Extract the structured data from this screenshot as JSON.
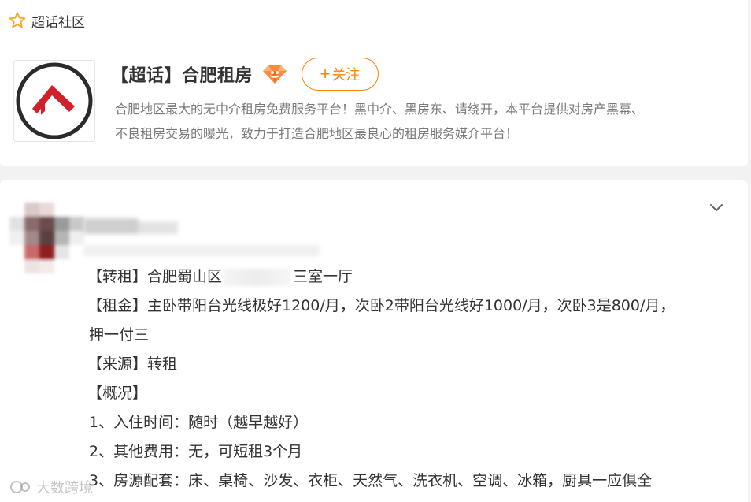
{
  "breadcrumb": {
    "icon": "star-outline-icon",
    "label": "超话社区"
  },
  "topic": {
    "title": "【超话】合肥租房",
    "badge_icon": "diamond-gem-icon",
    "follow_label": "关注",
    "follow_icon": "plus-icon",
    "description_lines": [
      "合肥地区最大的无中介租房免费服务平台！黑中介、黑房东、请绕开，本平台提供对房产黑幕、",
      "不良租房交易的曝光，致力于打造合肥地区最良心的租房服务媒介平台！"
    ],
    "logo_icon": "house-roof-logo-icon"
  },
  "post": {
    "menu_icon": "chevron-down-icon",
    "lines": {
      "l1_prefix": "【转租】合肥蜀山区",
      "l1_suffix": "三室一厅",
      "l2": "【租金】主卧带阳台光线极好1200/月，次卧2带阳台光线好1000/月，次卧3是800/月，",
      "l3": "押一付三",
      "l4": "【来源】转租",
      "l5": "【概况】",
      "l6": "1、入住时间：随时（越早越好）",
      "l7": "2、其他费用：无，可短租3个月",
      "l8": "3、房源配套：床、桌椅、沙发、衣柜、天然气、洗衣机、空调、冰箱，厨具一应俱全"
    }
  },
  "watermark": {
    "text": "大数跨境",
    "icon": "watermark-logo-icon"
  },
  "colors": {
    "accent": "#ff8200",
    "logo_red": "#d0212b",
    "text": "#333333",
    "muted": "#7a7a7a",
    "background": "#f2f2f2"
  }
}
